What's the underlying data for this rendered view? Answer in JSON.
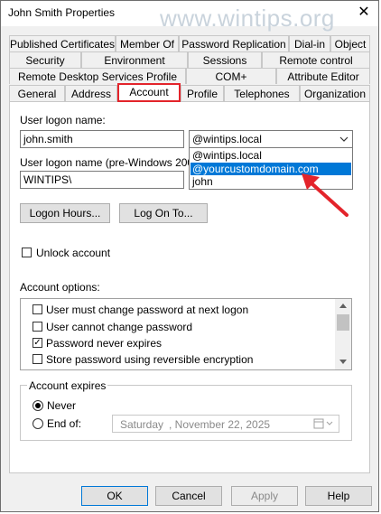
{
  "window": {
    "title": "John Smith Properties",
    "close_glyph": "✕",
    "watermark": "www.wintips.org"
  },
  "tabs": {
    "row1": [
      "Published Certificates",
      "Member Of",
      "Password Replication",
      "Dial-in",
      "Object"
    ],
    "row2": [
      "Security",
      "Environment",
      "Sessions",
      "Remote control"
    ],
    "row3": [
      "Remote Desktop Services Profile",
      "COM+",
      "Attribute Editor"
    ],
    "row4": [
      "General",
      "Address",
      "Account",
      "Profile",
      "Telephones",
      "Organization"
    ]
  },
  "account": {
    "logon_name_label": "User logon name:",
    "logon_name_value": "john.smith",
    "domain_selected": "@wintips.local",
    "domain_options": [
      "@wintips.local",
      "@yourcustomdomain.com",
      "john"
    ],
    "pre2000_label": "User logon name (pre-Windows 2000):",
    "pre2000_domain": "WINTIPS\\",
    "logon_hours_button": "Logon Hours...",
    "log_on_to_button": "Log On To...",
    "unlock_label": "Unlock account",
    "options_label": "Account options:",
    "options": [
      {
        "label": "User must change password at next logon",
        "checked": false
      },
      {
        "label": "User cannot change password",
        "checked": false
      },
      {
        "label": "Password never expires",
        "checked": true
      },
      {
        "label": "Store password using reversible encryption",
        "checked": false
      }
    ],
    "expires_label": "Account expires",
    "never_label": "Never",
    "end_of_label": "End of:",
    "date_day": "Saturday",
    "date_rest": ", November 22, 2025"
  },
  "buttons": {
    "ok": "OK",
    "cancel": "Cancel",
    "apply": "Apply",
    "help": "Help"
  },
  "colors": {
    "highlight": "#0078d7",
    "annotation_red": "#e3242b"
  }
}
